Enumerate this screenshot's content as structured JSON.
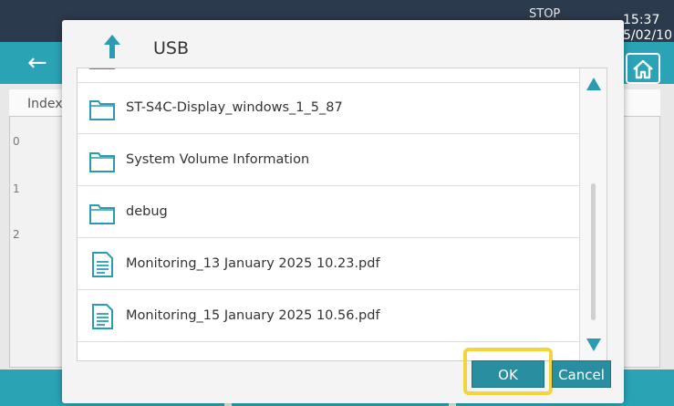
{
  "background": {
    "clock_time": "15:37",
    "clock_date": "5/02/10",
    "status_text": "STOP",
    "table_header": "Index",
    "row_indices": [
      "0",
      "1",
      "2"
    ]
  },
  "dialog": {
    "title": "USB",
    "items": [
      {
        "type": "folder",
        "name": "ST-S4C-Display_windows_1_5_87"
      },
      {
        "type": "folder",
        "name": "System Volume Information"
      },
      {
        "type": "folder",
        "name": "debug"
      },
      {
        "type": "pdf",
        "name": "Monitoring_13 January 2025 10.23.pdf"
      },
      {
        "type": "pdf",
        "name": "Monitoring_15 January 2025 10.56.pdf"
      }
    ],
    "ok_label": "OK",
    "cancel_label": "Cancel"
  },
  "colors": {
    "accent": "#2aa3b5",
    "button": "#2a8ea1",
    "highlight": "#f3d43b",
    "icon_blue": "#2a9bb0"
  }
}
